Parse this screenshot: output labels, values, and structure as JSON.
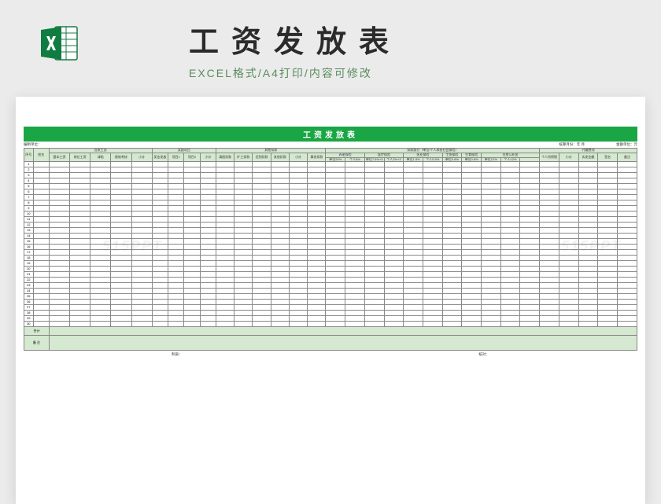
{
  "header": {
    "title": "工资发放表",
    "subtitle": "EXCEL格式/A4打印/内容可修改"
  },
  "watermark": "515PPT",
  "sheet": {
    "titleBar": "工资发放表",
    "meta": {
      "unitLabel": "编制单位：",
      "periodLabel": "核算月份：",
      "periodValue": "年  月",
      "moneyUnit": "金额单位：元"
    },
    "group1": {
      "seq": "序号",
      "name": "姓名",
      "payable": "应发工资",
      "basic": "基本工资",
      "post": "岗位工资",
      "allowance": "津贴",
      "perf": "绩效考核",
      "sub": "小计"
    },
    "group2": {
      "title": "奖励项目",
      "bonus": "奖金发放",
      "item1": "项目1",
      "item2": "项目2",
      "sub": "小计"
    },
    "group3": {
      "title": "其他扣款",
      "deduct": "请假扣款",
      "absent": "旷工扣款",
      "late": "迟到扣款",
      "other": "其他扣款",
      "sub": "小计",
      "actual": "事发扣款"
    },
    "group4": {
      "title": "扣款部分（单位/个人承担社会保险）",
      "pension": "养老保险",
      "pensionCo": "单位20%",
      "pensionSelf": "个人8%",
      "medical": "医疗保险",
      "medicalCo": "单位7.5%+3",
      "medicalSelf": "个人2%+3",
      "unemp": "失业保险",
      "unempCo": "单位1.5%",
      "unempSelf": "个人0.5%",
      "injury": "工伤保险",
      "injuryCo": "单位0.8%",
      "birth": "生育保险",
      "birthCo": "单位0.8%",
      "fund": "住房公积金",
      "fundCo": "单位12%",
      "fundSelf": "个人12%"
    },
    "group5": {
      "title": "代缴费项",
      "tax": "个人所得税",
      "sub": "小计",
      "actualPay": "实发金额",
      "sign": "签名",
      "remark": "备注"
    },
    "totalLabel": "合计",
    "remarkLabel": "备 注",
    "footer": {
      "maker": "制表：",
      "checker": "核对："
    },
    "rowCount": 30
  }
}
